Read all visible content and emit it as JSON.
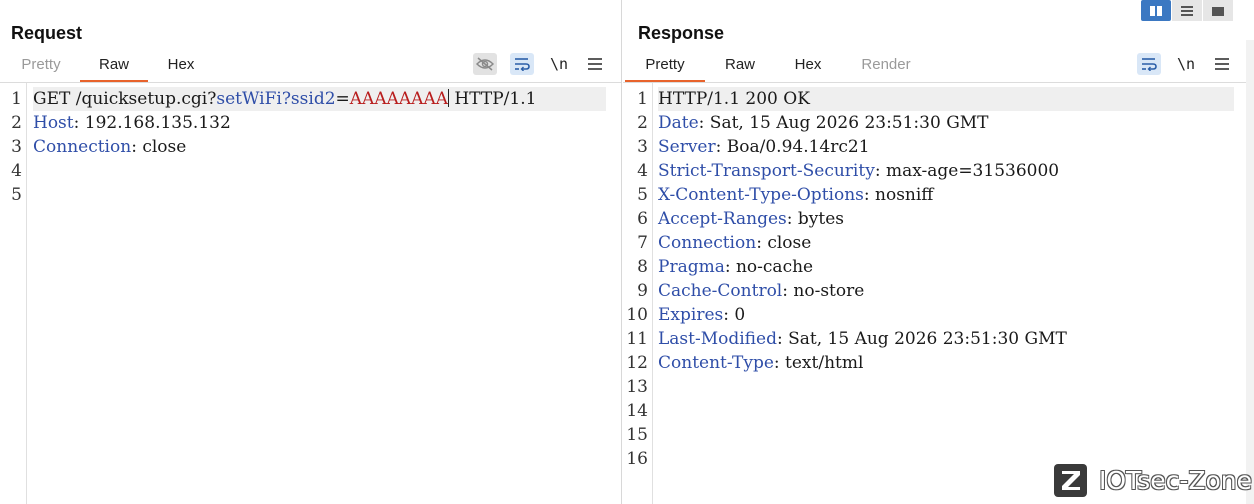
{
  "request": {
    "title": "Request",
    "tabs": [
      "Pretty",
      "Raw",
      "Hex"
    ],
    "active_tab": "Raw",
    "newline_label": "\\n",
    "line_numbers": [
      "1",
      "2",
      "3",
      "4",
      "5"
    ],
    "line1": {
      "method": "GET /quicksetup.cgi?",
      "param_name": "setWiFi?ssid2",
      "equals": "=",
      "param_value": "AAAAAAAA",
      "protocol": " HTTP/1.1"
    },
    "headers": [
      {
        "name": "Host",
        "value": " 192.168.135.132"
      },
      {
        "name": "Connection",
        "value": " close"
      }
    ]
  },
  "response": {
    "title": "Response",
    "tabs": [
      "Pretty",
      "Raw",
      "Hex",
      "Render"
    ],
    "active_tab": "Pretty",
    "newline_label": "\\n",
    "line_numbers": [
      "1",
      "2",
      "3",
      "4",
      "5",
      "6",
      "7",
      "8",
      "9",
      "10",
      "11",
      "12",
      "13",
      "14",
      "15",
      "16"
    ],
    "status_line": "HTTP/1.1 200 OK",
    "headers": [
      {
        "name": "Date",
        "value": " Sat, 15 Aug 2026 23:51:30 GMT"
      },
      {
        "name": "Server",
        "value": " Boa/0.94.14rc21"
      },
      {
        "name": "Strict-Transport-Security",
        "value": " max-age=31536000"
      },
      {
        "name": "X-Content-Type-Options",
        "value": " nosniff"
      },
      {
        "name": "Accept-Ranges",
        "value": " bytes"
      },
      {
        "name": "Connection",
        "value": " close"
      },
      {
        "name": "Pragma",
        "value": " no-cache"
      },
      {
        "name": "Cache-Control",
        "value": " no-store"
      },
      {
        "name": "Expires",
        "value": " 0"
      },
      {
        "name": "Last-Modified",
        "value": " Sat, 15 Aug 2026 23:51:30 GMT"
      },
      {
        "name": "Content-Type",
        "value": " text/html"
      }
    ]
  },
  "watermark": {
    "text": "IOTsec-Zone",
    "logo_letter": "Z"
  },
  "colors": {
    "accent_tab": "#e8632c",
    "header_key": "#2f4ea8",
    "param_value": "#b81c1c",
    "view_active": "#3b78c2"
  }
}
